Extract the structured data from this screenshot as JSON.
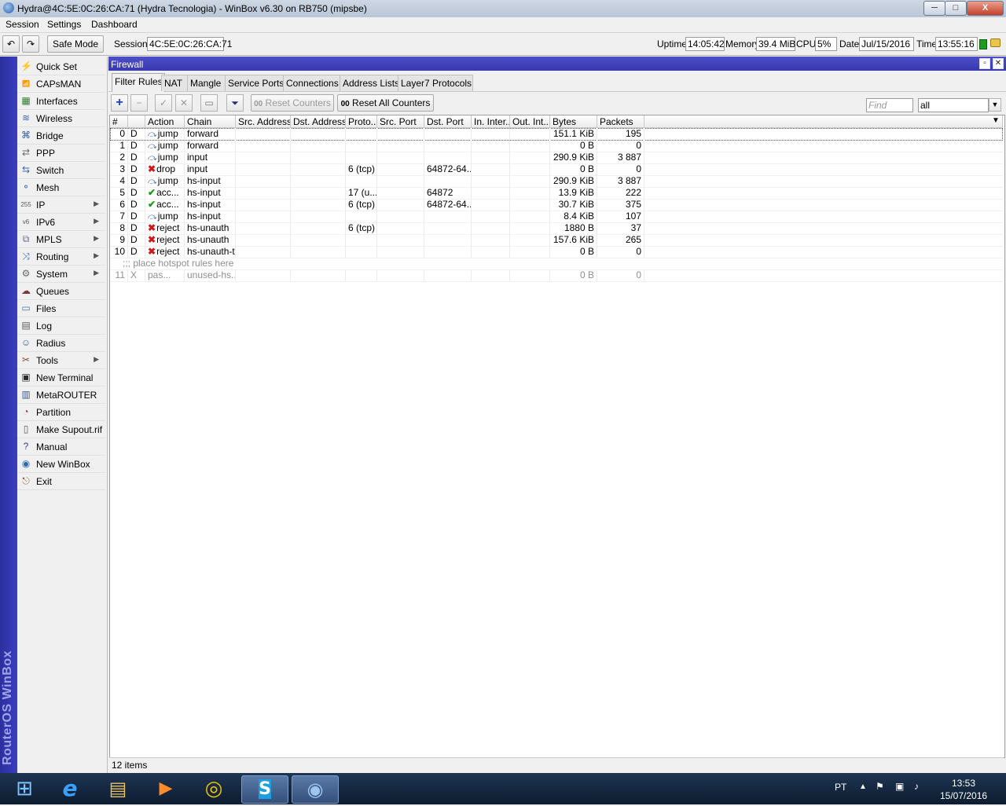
{
  "window": {
    "title": "Hydra@4C:5E:0C:26:CA:71 (Hydra Tecnologia) - WinBox v6.30 on RB750 (mipsbe)",
    "controls": {
      "minimize": "─",
      "maximize": "□",
      "close": "X"
    }
  },
  "menu": [
    "Session",
    "Settings",
    "Dashboard"
  ],
  "toolbar": {
    "undo_icon": "↶",
    "redo_icon": "↷",
    "safe_mode": "Safe Mode",
    "session_label": "Session:",
    "session_value": "4C:5E:0C:26:CA:71",
    "uptime_label": "Uptime:",
    "uptime_value": "14:05:42",
    "memory_label": "Memory:",
    "memory_value": "39.4 MiB",
    "cpu_label": "CPU:",
    "cpu_value": "5%",
    "date_label": "Date:",
    "date_value": "Jul/15/2016",
    "time_label": "Time:",
    "time_value": "13:55:16"
  },
  "vertical_brand": "RouterOS WinBox",
  "sidebar": {
    "items": [
      {
        "label": "Quick Set",
        "icon": "quickset-icon",
        "glyph": "⚡",
        "submenu": false
      },
      {
        "label": "CAPsMAN",
        "icon": "capsman-icon",
        "glyph": "📶",
        "submenu": false
      },
      {
        "label": "Interfaces",
        "icon": "interfaces-icon",
        "glyph": "▦",
        "submenu": false
      },
      {
        "label": "Wireless",
        "icon": "wireless-icon",
        "glyph": "≋",
        "submenu": false
      },
      {
        "label": "Bridge",
        "icon": "bridge-icon",
        "glyph": "⌘",
        "submenu": false
      },
      {
        "label": "PPP",
        "icon": "ppp-icon",
        "glyph": "⇄",
        "submenu": false
      },
      {
        "label": "Switch",
        "icon": "switch-icon",
        "glyph": "⇆",
        "submenu": false
      },
      {
        "label": "Mesh",
        "icon": "mesh-icon",
        "glyph": "⚬",
        "submenu": false
      },
      {
        "label": "IP",
        "icon": "ip-icon",
        "glyph": "255",
        "submenu": true
      },
      {
        "label": "IPv6",
        "icon": "ipv6-icon",
        "glyph": "v6",
        "submenu": true
      },
      {
        "label": "MPLS",
        "icon": "mpls-icon",
        "glyph": "⧉",
        "submenu": true
      },
      {
        "label": "Routing",
        "icon": "routing-icon",
        "glyph": "⤨",
        "submenu": true
      },
      {
        "label": "System",
        "icon": "system-icon",
        "glyph": "⚙",
        "submenu": true
      },
      {
        "label": "Queues",
        "icon": "queues-icon",
        "glyph": "☁",
        "submenu": false
      },
      {
        "label": "Files",
        "icon": "files-icon",
        "glyph": "▭",
        "submenu": false
      },
      {
        "label": "Log",
        "icon": "log-icon",
        "glyph": "▤",
        "submenu": false
      },
      {
        "label": "Radius",
        "icon": "radius-icon",
        "glyph": "☺",
        "submenu": false
      },
      {
        "label": "Tools",
        "icon": "tools-icon",
        "glyph": "✂",
        "submenu": true
      },
      {
        "label": "New Terminal",
        "icon": "terminal-icon",
        "glyph": "▣",
        "submenu": false
      },
      {
        "label": "MetaROUTER",
        "icon": "metarouter-icon",
        "glyph": "▥",
        "submenu": false
      },
      {
        "label": "Partition",
        "icon": "partition-icon",
        "glyph": "◔",
        "submenu": false
      },
      {
        "label": "Make Supout.rif",
        "icon": "supout-icon",
        "glyph": "▯",
        "submenu": false
      },
      {
        "label": "Manual",
        "icon": "manual-icon",
        "glyph": "?",
        "submenu": false
      },
      {
        "label": "New WinBox",
        "icon": "winbox-icon",
        "glyph": "◉",
        "submenu": false
      },
      {
        "label": "Exit",
        "icon": "exit-icon",
        "glyph": "⎋",
        "submenu": false
      }
    ]
  },
  "firewall": {
    "title": "Firewall",
    "tabs": [
      "Filter Rules",
      "NAT",
      "Mangle",
      "Service Ports",
      "Connections",
      "Address Lists",
      "Layer7 Protocols"
    ],
    "active_tab": "Filter Rules",
    "tools": {
      "add": "+",
      "remove": "−",
      "enable": "✓",
      "disable": "✕",
      "comment": "▭",
      "filter": "⏷",
      "reset_counters": "Reset Counters",
      "reset_counters_prefix": "00",
      "reset_all_counters": "Reset All Counters",
      "reset_all_counters_prefix": "00",
      "find_placeholder": "Find",
      "scope_value": "all"
    },
    "columns": [
      "#",
      "",
      "Action",
      "Chain",
      "Src. Address",
      "Dst. Address",
      "Proto...",
      "Src. Port",
      "Dst. Port",
      "In. Inter...",
      "Out. Int...",
      "Bytes",
      "Packets"
    ],
    "rows": [
      {
        "num": "0",
        "flag": "D",
        "action": "jump",
        "action_type": "jump",
        "chain": "forward",
        "src": "",
        "dst": "",
        "proto": "",
        "sport": "",
        "dport": "",
        "in": "",
        "out": "",
        "bytes": "151.1 KiB",
        "packets": "195",
        "selected": true
      },
      {
        "num": "1",
        "flag": "D",
        "action": "jump",
        "action_type": "jump",
        "chain": "forward",
        "src": "",
        "dst": "",
        "proto": "",
        "sport": "",
        "dport": "",
        "in": "",
        "out": "",
        "bytes": "0 B",
        "packets": "0"
      },
      {
        "num": "2",
        "flag": "D",
        "action": "jump",
        "action_type": "jump",
        "chain": "input",
        "src": "",
        "dst": "",
        "proto": "",
        "sport": "",
        "dport": "",
        "in": "",
        "out": "",
        "bytes": "290.9 KiB",
        "packets": "3 887"
      },
      {
        "num": "3",
        "flag": "D",
        "action": "drop",
        "action_type": "drop",
        "chain": "input",
        "src": "",
        "dst": "",
        "proto": "6 (tcp)",
        "sport": "",
        "dport": "64872-64...",
        "in": "",
        "out": "",
        "bytes": "0 B",
        "packets": "0"
      },
      {
        "num": "4",
        "flag": "D",
        "action": "jump",
        "action_type": "jump",
        "chain": "hs-input",
        "src": "",
        "dst": "",
        "proto": "",
        "sport": "",
        "dport": "",
        "in": "",
        "out": "",
        "bytes": "290.9 KiB",
        "packets": "3 887"
      },
      {
        "num": "5",
        "flag": "D",
        "action": "acc...",
        "action_type": "accept",
        "chain": "hs-input",
        "src": "",
        "dst": "",
        "proto": "17 (u...",
        "sport": "",
        "dport": "64872",
        "in": "",
        "out": "",
        "bytes": "13.9 KiB",
        "packets": "222"
      },
      {
        "num": "6",
        "flag": "D",
        "action": "acc...",
        "action_type": "accept",
        "chain": "hs-input",
        "src": "",
        "dst": "",
        "proto": "6 (tcp)",
        "sport": "",
        "dport": "64872-64...",
        "in": "",
        "out": "",
        "bytes": "30.7 KiB",
        "packets": "375"
      },
      {
        "num": "7",
        "flag": "D",
        "action": "jump",
        "action_type": "jump",
        "chain": "hs-input",
        "src": "",
        "dst": "",
        "proto": "",
        "sport": "",
        "dport": "",
        "in": "",
        "out": "",
        "bytes": "8.4 KiB",
        "packets": "107"
      },
      {
        "num": "8",
        "flag": "D",
        "action": "reject",
        "action_type": "reject",
        "chain": "hs-unauth",
        "src": "",
        "dst": "",
        "proto": "6 (tcp)",
        "sport": "",
        "dport": "",
        "in": "",
        "out": "",
        "bytes": "1880 B",
        "packets": "37"
      },
      {
        "num": "9",
        "flag": "D",
        "action": "reject",
        "action_type": "reject",
        "chain": "hs-unauth",
        "src": "",
        "dst": "",
        "proto": "",
        "sport": "",
        "dport": "",
        "in": "",
        "out": "",
        "bytes": "157.6 KiB",
        "packets": "265"
      },
      {
        "num": "10",
        "flag": "D",
        "action": "reject",
        "action_type": "reject",
        "chain": "hs-unauth-to",
        "src": "",
        "dst": "",
        "proto": "",
        "sport": "",
        "dport": "",
        "in": "",
        "out": "",
        "bytes": "0 B",
        "packets": "0"
      },
      {
        "comment": ";;; place hotspot rules here"
      },
      {
        "num": "11",
        "flag": "X",
        "action": "pas...",
        "action_type": "passthrough",
        "chain": "unused-hs...",
        "src": "",
        "dst": "",
        "proto": "",
        "sport": "",
        "dport": "",
        "in": "",
        "out": "",
        "bytes": "0 B",
        "packets": "0",
        "disabled": true
      }
    ],
    "status": "12 items"
  },
  "taskbar": {
    "apps": [
      {
        "name": "start-button",
        "glyph": "⊞"
      },
      {
        "name": "internet-explorer-icon",
        "glyph": "e"
      },
      {
        "name": "file-explorer-icon",
        "glyph": "▤"
      },
      {
        "name": "media-player-icon",
        "glyph": "▶"
      },
      {
        "name": "chrome-icon",
        "glyph": "◎"
      },
      {
        "name": "skype-icon",
        "glyph": "S"
      },
      {
        "name": "winbox-taskbar-icon",
        "glyph": "◉"
      }
    ],
    "lang": "PT",
    "clock_time": "13:53",
    "clock_date": "15/07/2016"
  },
  "colors": {
    "accent": "#3838b0",
    "strip": "#2b2f9e",
    "accept": "#1a9a1a",
    "reject": "#d01818",
    "taskbar": "#14263d"
  }
}
